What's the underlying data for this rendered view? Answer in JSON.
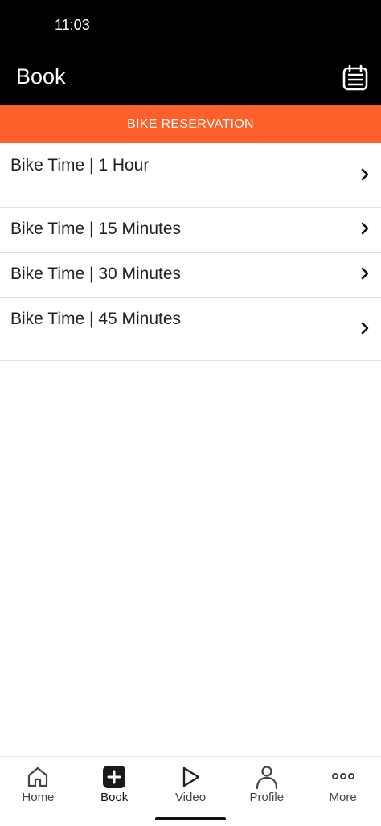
{
  "status_bar": {
    "time": "11:03"
  },
  "header": {
    "title": "Book",
    "calendar_icon": "calendar-icon"
  },
  "banner": {
    "label": "BIKE RESERVATION",
    "color": "#ff5f2b"
  },
  "items": [
    {
      "label": "Bike Time | 1 Hour"
    },
    {
      "label": "Bike Time | 15 Minutes"
    },
    {
      "label": "Bike Time | 30 Minutes"
    },
    {
      "label": "Bike Time | 45 Minutes"
    }
  ],
  "tabs": [
    {
      "label": "Home",
      "icon": "home-icon"
    },
    {
      "label": "Book",
      "icon": "add-icon",
      "active": true
    },
    {
      "label": "Video",
      "icon": "play-icon"
    },
    {
      "label": "Profile",
      "icon": "profile-icon"
    },
    {
      "label": "More",
      "icon": "more-icon"
    }
  ]
}
